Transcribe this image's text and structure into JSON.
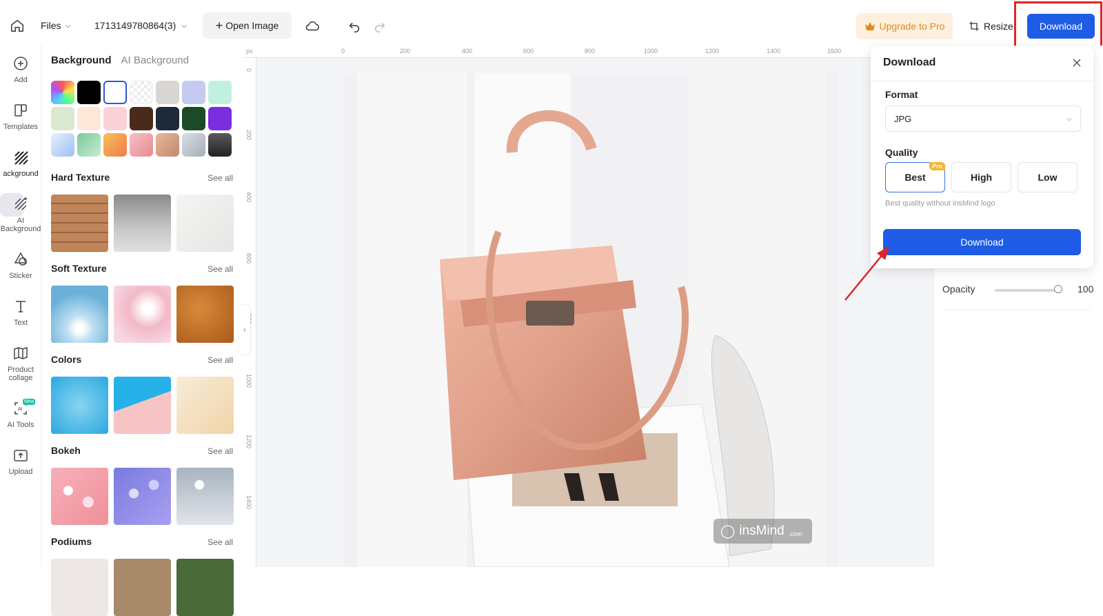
{
  "topbar": {
    "files_label": "Files",
    "filename": "1713149780864(3)",
    "open_image_label": "Open Image",
    "upgrade_label": "Upgrade to Pro",
    "resize_label": "Resize",
    "download_label": "Download"
  },
  "leftnav": {
    "items": [
      {
        "label": "Add",
        "icon": "plus-circle-icon"
      },
      {
        "label": "Templates",
        "icon": "templates-icon"
      },
      {
        "label": "ackground",
        "icon": "background-stripes-icon"
      },
      {
        "label": "AI Background",
        "icon": "ai-background-icon"
      },
      {
        "label": "Sticker",
        "icon": "sticker-icon"
      },
      {
        "label": "Text",
        "icon": "text-icon"
      },
      {
        "label": "Product collage",
        "icon": "collage-icon"
      },
      {
        "label": "AI Tools",
        "icon": "ai-tools-icon",
        "badge": "New"
      },
      {
        "label": "Upload",
        "icon": "upload-icon"
      }
    ]
  },
  "panel": {
    "tab_background": "Background",
    "tab_ai_background": "AI Background",
    "see_all": "See all",
    "sections": {
      "hard_texture": "Hard Texture",
      "soft_texture": "Soft Texture",
      "colors": "Colors",
      "bokeh": "Bokeh",
      "podiums": "Podiums"
    },
    "swatch_colors": [
      "#000000",
      "#ffffff",
      "#d8d6d0",
      "#c5caf0",
      "#c2f0e0",
      "#dbe8cf",
      "#fde8d8",
      "#fbd0d6",
      "#4a2a1a",
      "#1e2a3a",
      "#1c4a28",
      "#7a2ee0",
      "#cfe3fb",
      "#9ed8b0",
      "#f7a055",
      "#f0a0a6",
      "#d8a080",
      "#b8c0cc",
      "#3a3a3a"
    ]
  },
  "ruler": {
    "unit": "px",
    "top_ticks": [
      "0",
      "200",
      "400",
      "600",
      "800",
      "1000",
      "1200",
      "1400",
      "1600"
    ],
    "left_ticks": [
      "0",
      "200",
      "400",
      "600",
      "800",
      "1000",
      "1200",
      "1400"
    ]
  },
  "right_panel": {
    "opacity_label": "Opacity",
    "opacity_value": "100"
  },
  "download_panel": {
    "title": "Download",
    "format_label": "Format",
    "format_value": "JPG",
    "quality_label": "Quality",
    "quality_best": "Best",
    "quality_high": "High",
    "quality_low": "Low",
    "pro_badge": "Pro",
    "quality_hint": "Best quality without insMind logo",
    "download_button": "Download"
  },
  "watermark": {
    "text": "insMind",
    "suffix": ".com"
  }
}
